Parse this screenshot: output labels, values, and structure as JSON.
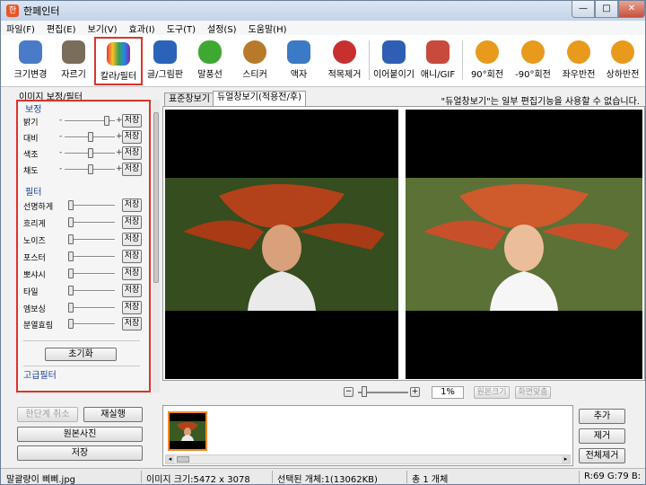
{
  "window": {
    "title": "한페인터",
    "min": "—",
    "max": "□",
    "close": "✕"
  },
  "menu": [
    "파일(F)",
    "편집(E)",
    "보기(V)",
    "효과(I)",
    "도구(T)",
    "설정(S)",
    "도움말(H)"
  ],
  "toolbar": [
    {
      "label": "크기변경",
      "icon": "resize-icon",
      "color": "#4a7bc8"
    },
    {
      "label": "자르기",
      "icon": "crop-icon",
      "color": "#7a6d5a"
    },
    {
      "label": "칼라/필터",
      "icon": "color-filter-icon",
      "color": "#c4327a"
    },
    {
      "label": "글/그림판",
      "icon": "text-draw-icon",
      "color": "#2b63b8"
    },
    {
      "label": "말풍선",
      "icon": "speech-bubble-icon",
      "color": "#3ea832"
    },
    {
      "label": "스티커",
      "icon": "sticker-icon",
      "color": "#b87a2a"
    },
    {
      "label": "액자",
      "icon": "frame-icon",
      "color": "#3b7ac4"
    },
    {
      "label": "적목제거",
      "icon": "red-eye-icon",
      "color": "#c83030"
    },
    {
      "label": "이어붙이기",
      "icon": "merge-icon",
      "color": "#2e5fb4"
    },
    {
      "label": "애니/GIF",
      "icon": "gif-icon",
      "color": "#c84a3c"
    },
    {
      "label": "90°회전",
      "icon": "rotate-cw-icon",
      "color": "#e89a1c"
    },
    {
      "label": "-90°회전",
      "icon": "rotate-ccw-icon",
      "color": "#e89a1c"
    },
    {
      "label": "좌우반전",
      "icon": "flip-horizontal-icon",
      "color": "#e89a1c"
    },
    {
      "label": "상하반전",
      "icon": "flip-vertical-icon",
      "color": "#e89a1c"
    }
  ],
  "panel": {
    "title": "이미지 보정/필터",
    "section_adjust": "보정",
    "adjust": [
      {
        "label": "밝기",
        "value": 0.85
      },
      {
        "label": "대비",
        "value": 0.5
      },
      {
        "label": "색조",
        "value": 0.5
      },
      {
        "label": "채도",
        "value": 0.5
      }
    ],
    "section_filter": "필터",
    "filters": [
      {
        "label": "선명하게"
      },
      {
        "label": "흐리게"
      },
      {
        "label": "노이즈"
      },
      {
        "label": "포스터"
      },
      {
        "label": "뽀샤시"
      },
      {
        "label": "타일"
      },
      {
        "label": "엠보싱"
      },
      {
        "label": "분열효림"
      }
    ],
    "save": "저장",
    "reset": "초기화",
    "advanced": "고급필터"
  },
  "actions": {
    "undo": "한단계 취소",
    "redo": "재실행",
    "original": "원본사진",
    "save": "저장"
  },
  "tabs": {
    "standard": "표준창보기",
    "dual": "듀얼창보기(적용전/후)",
    "note": "\"듀얼창보기\"는 일부 편집기능을 사용할 수 없습니다."
  },
  "zoom": {
    "value": "1%",
    "original": "원본크기",
    "fit": "화면맞춤",
    "level": 0.08
  },
  "side": {
    "add": "추가",
    "remove": "제거",
    "remove_all": "전체제거"
  },
  "status": {
    "filename": "말괄량이 삐삐.jpg",
    "size": "이미지 크기:5472 x 3078",
    "selected": "선택된 개체:1(13062KB)",
    "total": "총 1 개체",
    "pixel": "R:69 G:79 B:"
  }
}
